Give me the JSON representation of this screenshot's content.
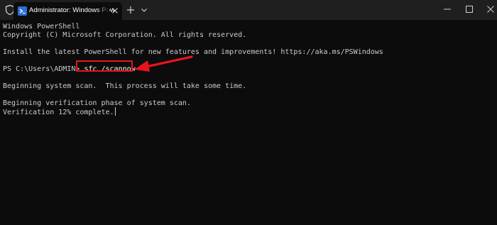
{
  "window": {
    "tab_title": "Administrator: Windows PowerShell",
    "icons": {
      "shield": "shield-icon",
      "tab": "powershell-icon",
      "tab_close": "close-icon",
      "new_tab": "plus-icon",
      "dropdown": "chevron-down-icon",
      "minimize": "minimize-icon",
      "maximize": "maximize-icon",
      "close": "close-icon"
    }
  },
  "terminal": {
    "lines": {
      "header": "Windows PowerShell",
      "copyright": "Copyright (C) Microsoft Corporation. All rights reserved.",
      "install_notice": "Install the latest PowerShell for new features and improvements! https://aka.ms/PSWindows",
      "prompt": "PS C:\\Users\\ADMIN> ",
      "command": "sfc /scannow",
      "scan_begin": "Beginning system scan.  This process will take some time.",
      "verify_begin": "Beginning verification phase of system scan.",
      "verify_progress": "Verification 12% complete."
    }
  },
  "colors": {
    "terminal_bg": "#0c0c0c",
    "titlebar_bg": "#1f1f1f",
    "text": "#cccccc",
    "annotation": "#e8141b"
  }
}
